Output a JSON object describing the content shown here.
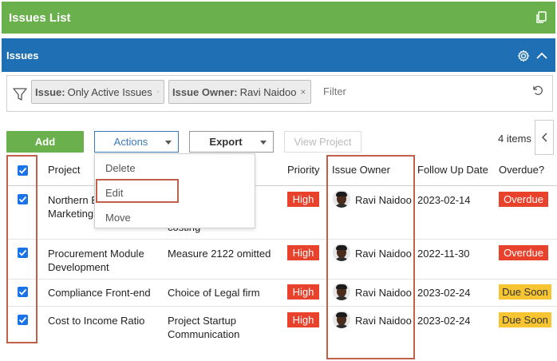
{
  "window": {
    "title": "Issues List",
    "copy_icon": "copy-window-icon"
  },
  "panel": {
    "title": "Issues",
    "settings_icon": "gear-icon",
    "collapse_icon": "chevron-up-icon"
  },
  "filters": {
    "chips": [
      {
        "label": "Issue:",
        "value": "Only Active Issues"
      },
      {
        "label": "Issue Owner:",
        "value": "Ravi Naidoo"
      }
    ],
    "placeholder": "Filter"
  },
  "toolbar": {
    "add_label": "Add",
    "actions_label": "Actions",
    "export_label": "Export",
    "view_project_label": "View Project",
    "items_count": "4 items"
  },
  "actions_menu": [
    "Delete",
    "Edit",
    "Move"
  ],
  "table": {
    "headers": {
      "project": "Project",
      "priority": "Priority",
      "issue_owner": "Issue Owner",
      "follow_up_date": "Follow Up Date",
      "overdue": "Overdue?"
    },
    "rows": [
      {
        "project_line1": "Northern E",
        "project_line2": "Marketing",
        "issue_line1": "",
        "issue_line2": "d",
        "issue_line3": "costing",
        "priority": "High",
        "owner": "Ravi Naidoo",
        "follow_up": "2023-02-14",
        "overdue": "Overdue"
      },
      {
        "project_line1": "Procurement Module",
        "project_line2": "Development",
        "issue_line1": "Measure 2122 omitted",
        "issue_line2": "",
        "issue_line3": "",
        "priority": "High",
        "owner": "Ravi Naidoo",
        "follow_up": "2022-11-30",
        "overdue": "Overdue"
      },
      {
        "project_line1": "Compliance Front-end",
        "project_line2": "",
        "issue_line1": "Choice of Legal firm",
        "issue_line2": "",
        "issue_line3": "",
        "priority": "High",
        "owner": "Ravi Naidoo",
        "follow_up": "2023-02-24",
        "overdue": "Due Soon"
      },
      {
        "project_line1": "Cost to Income Ratio",
        "project_line2": "",
        "issue_line1": "Project Startup",
        "issue_line2": "Communication",
        "issue_line3": "",
        "priority": "High",
        "owner": "Ravi Naidoo",
        "follow_up": "2023-02-24",
        "overdue": "Due Soon"
      }
    ]
  },
  "colors": {
    "title_green": "#6ab04c",
    "panel_blue": "#1e6fb4",
    "badge_red": "#e8412c",
    "badge_yellow": "#f7c531",
    "highlight_box": "#c0604a"
  }
}
